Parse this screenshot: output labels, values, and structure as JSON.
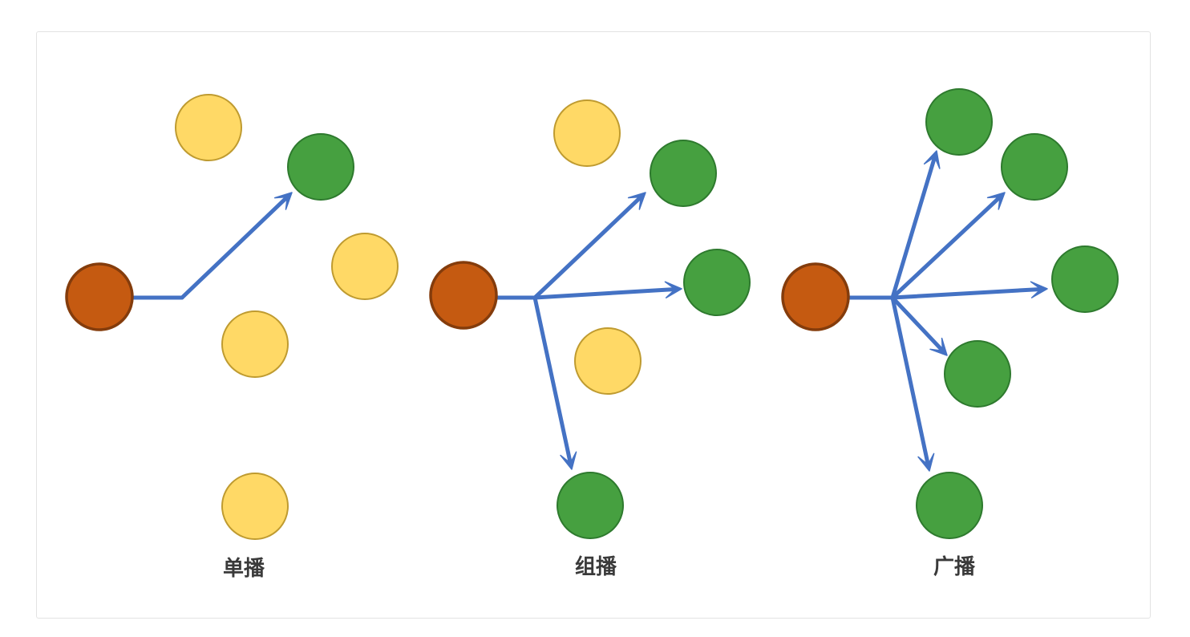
{
  "colors": {
    "source": "#C55A11",
    "source_stroke": "#843C0C",
    "receiver": "#46A040",
    "receiver_stroke": "#2E7A2E",
    "non_receiver": "#FFD966",
    "non_receiver_stroke": "#BF9B30",
    "arrow": "#4472C4"
  },
  "panels": [
    {
      "id": "unicast",
      "label": "单播"
    },
    {
      "id": "multicast",
      "label": "组播"
    },
    {
      "id": "broadcast",
      "label": "广播"
    }
  ]
}
